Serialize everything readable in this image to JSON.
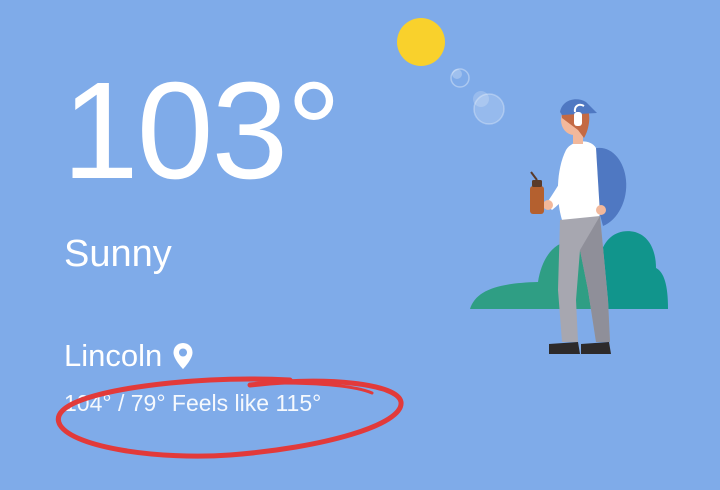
{
  "weather": {
    "temperature": "103°",
    "condition": "Sunny",
    "location": "Lincoln",
    "high_low_feels": "104° / 79° Feels like 115°"
  },
  "icons": {
    "location": "location-pin-icon",
    "sun": "sun-icon"
  },
  "colors": {
    "background": "#7fabe9",
    "sun": "#f9d12c",
    "annotation": "#e23a3a",
    "hill_left": "#2f9e84",
    "hill_right": "#11958c"
  }
}
